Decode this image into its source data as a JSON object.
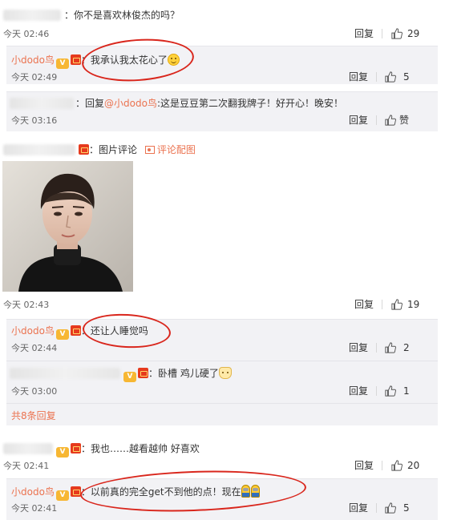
{
  "comments": [
    {
      "text": "：你不是喜欢林俊杰的吗？",
      "time": "今天 02:46",
      "reply_label": "回复",
      "likes": "29",
      "subs": [
        {
          "user": "小dodo鸟",
          "text": "：我承认我太花心了",
          "time": "今天 02:49",
          "reply_label": "回复",
          "likes": "5"
        },
        {
          "prefix": "：回复",
          "mention": "@小dodo鸟",
          "text": ":这是豆豆第二次翻我牌子！好开心！晚安！",
          "time": "今天 03:16",
          "reply_label": "回复",
          "likes": "赞"
        }
      ]
    },
    {
      "pic_label": "图片评论",
      "view_pic_label": "评论配图",
      "time": "今天 02:43",
      "reply_label": "回复",
      "likes": "19",
      "subs": [
        {
          "user": "小dodo鸟",
          "text": "：还让人睡觉吗",
          "time": "今天 02:44",
          "reply_label": "回复",
          "likes": "2"
        },
        {
          "text": "：卧槽 鸡儿硬了",
          "time": "今天 03:00",
          "reply_label": "回复",
          "likes": "1"
        }
      ],
      "more_label": "共8条回复"
    },
    {
      "text": "：我也……越看越帅 好喜欢",
      "time": "今天 02:41",
      "reply_label": "回复",
      "likes": "20",
      "subs": [
        {
          "user": "小dodo鸟",
          "text": "：以前真的完全get不到他的点！现在",
          "time": "今天 02:41",
          "reply_label": "回复",
          "likes": "5"
        }
      ]
    }
  ],
  "icons": {
    "badge": "red-envelope-badge-icon",
    "vip": "vip-crown-icon",
    "like": "thumbs-up-icon",
    "emoji_smile": "smile-emoji-icon",
    "emoji_cat": "cat-emoji-icon",
    "emoji_minion": "minion-emoji-icon",
    "pic": "picture-icon"
  },
  "colors": {
    "username": "#eb7350",
    "subbox": "#f2f2f5",
    "annotation": "#d9261c"
  }
}
